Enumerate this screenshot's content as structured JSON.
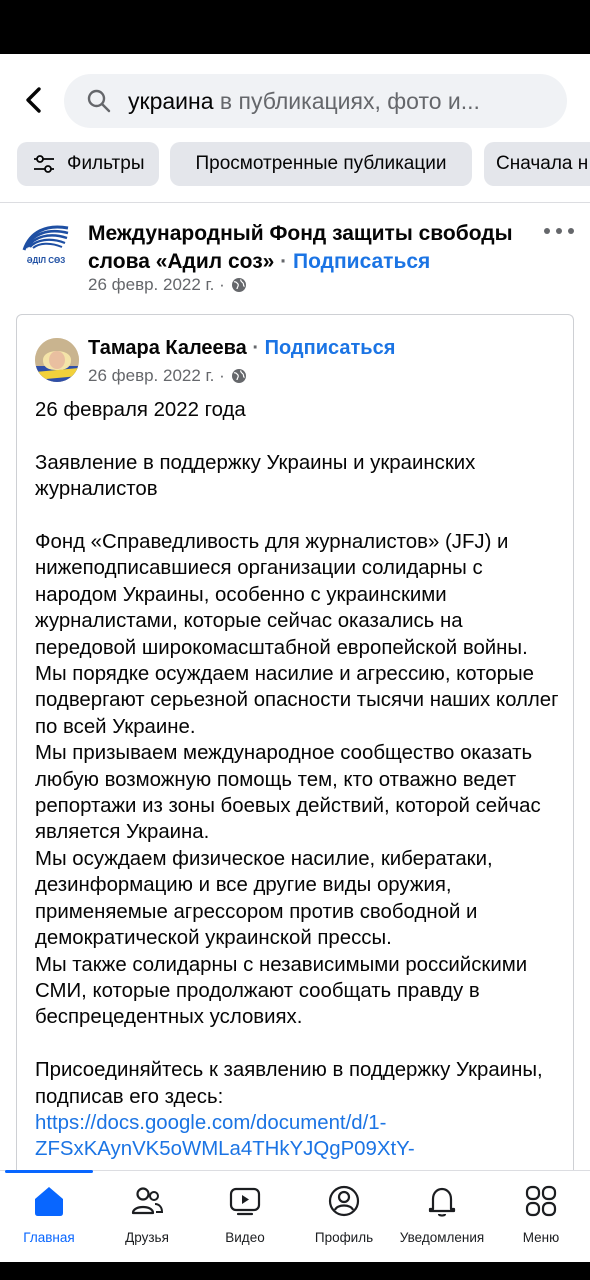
{
  "search": {
    "query": "украина",
    "scope_hint": " в публикациях, фото и..."
  },
  "filters": [
    {
      "label": "Фильтры"
    },
    {
      "label": "Просмотренные публикации"
    },
    {
      "label": "Сначала н"
    }
  ],
  "post": {
    "author": "Международный Фонд защиты свободы слова «Адил соз»",
    "separator": " · ",
    "subscribe": "Подписаться",
    "date": "26 февр. 2022 г. ·",
    "logo_text": "ӘДІЛ СӨЗ",
    "shared": {
      "author": "Тамара Калеева",
      "separator": " · ",
      "subscribe": "Подписаться",
      "date": "26 февр. 2022 г. ·",
      "paragraphs": [
        "26 февраля 2022 года",
        "",
        "Заявление в поддержку Украины и украинских журналистов",
        "",
        "Фонд «Справедливость для журналистов» (JFJ) и нижеподписавшиеся организации солидарны с народом Украины, особенно с украинскими журналистами, которые сейчас оказались на передовой широкомасштабной европейской войны.",
        "Мы порядке осуждаем насилие и агрессию, которые подвергают серьезной опасности тысячи наших коллег по всей Украине.",
        "Мы призываем международное сообщество оказать любую возможную помощь тем, кто отважно ведет репортажи из зоны боевых действий, которой сейчас является Украина.",
        "Мы осуждаем физическое насилие, кибератаки, дезинформацию и все другие виды оружия, применяемые агрессором против свободной и демократической украинской прессы.",
        "Мы также солидарны с независимыми российскими СМИ, которые продолжают сообщать правду в беспрецедентных условиях.",
        "",
        "Присоединяйтесь к заявлению в поддержку Украины, подписав его здесь: "
      ],
      "link": "https://docs.google.com/document/d/1-ZFSxKAynVK5oWMLa4THkYJQgP09XtY-"
    }
  },
  "nav": [
    {
      "label": "Главная",
      "icon": "home-icon",
      "active": true
    },
    {
      "label": "Друзья",
      "icon": "friends-icon"
    },
    {
      "label": "Видео",
      "icon": "video-icon"
    },
    {
      "label": "Профиль",
      "icon": "profile-icon"
    },
    {
      "label": "Уведомления",
      "icon": "bell-icon"
    },
    {
      "label": "Меню",
      "icon": "menu-icon"
    }
  ],
  "colors": {
    "accent": "#1b74e4",
    "nav_active": "#0866ff",
    "chip_bg": "#e4e6eb",
    "search_bg": "#f0f2f5",
    "muted_text": "#65676b"
  }
}
